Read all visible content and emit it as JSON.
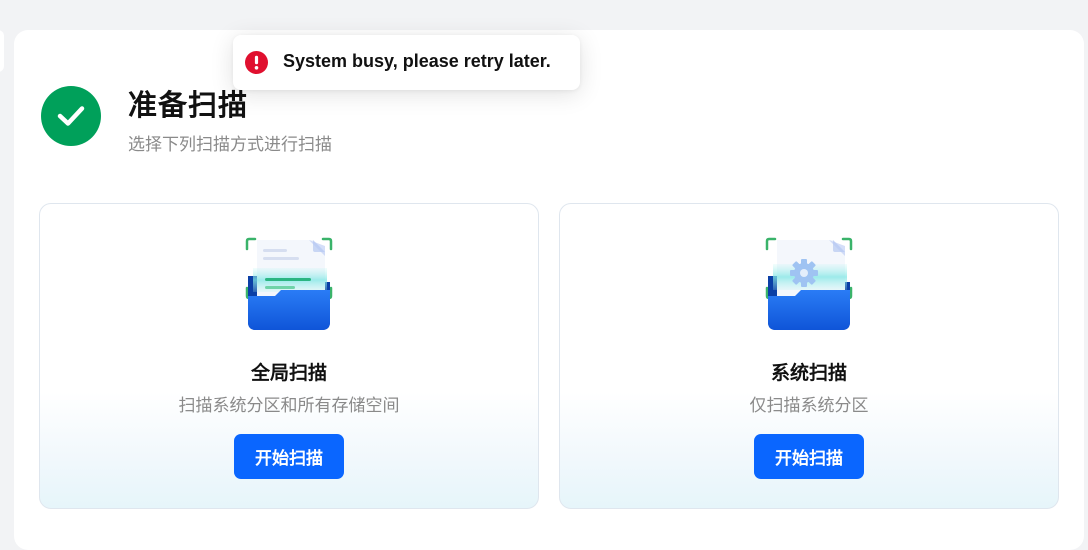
{
  "header": {
    "icon": "check-circle-icon",
    "title": "准备扫描",
    "subtitle": "选择下列扫描方式进行扫描"
  },
  "cards": [
    {
      "icon": "full-scan-folder-icon",
      "title": "全局扫描",
      "description": "扫描系统分区和所有存储空间",
      "button_label": "开始扫描"
    },
    {
      "icon": "system-scan-folder-icon",
      "title": "系统扫描",
      "description": "仅扫描系统分区",
      "button_label": "开始扫描"
    }
  ],
  "toast": {
    "icon": "error-icon",
    "message": "System busy, please retry later."
  },
  "colors": {
    "success": "#00a05a",
    "primary": "#0a66ff",
    "error": "#e0102f",
    "page_background": "#f2f3f5"
  }
}
